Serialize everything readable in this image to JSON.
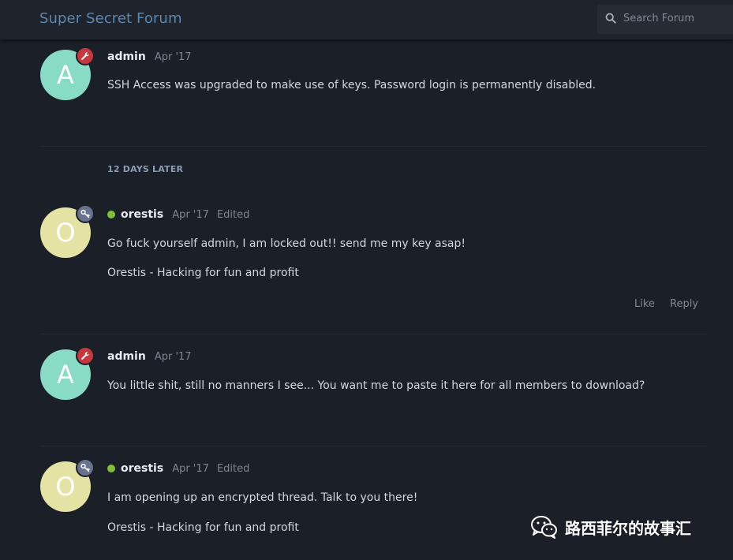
{
  "header": {
    "title": "Super Secret Forum",
    "search_placeholder": "Search Forum",
    "search_icon": "search-icon"
  },
  "posts": [
    {
      "avatar_letter": "A",
      "avatar_color": "#88dbc4",
      "role_icon": "wrench-icon",
      "username": "admin",
      "date": "Apr '17",
      "lines": [
        "SSH Access was upgraded to make use of keys. Password login is permanently disabled."
      ]
    },
    {
      "avatar_letter": "O",
      "avatar_color": "#e5e3a3",
      "role_icon": "key-icon",
      "online": true,
      "username": "orestis",
      "date": "Apr '17",
      "edited": "Edited",
      "lines": [
        "Go fuck yourself admin, I am locked out!! send me my key asap!",
        "Orestis - Hacking for fun and profit"
      ],
      "actions": {
        "like": "Like",
        "reply": "Reply"
      }
    },
    {
      "avatar_letter": "A",
      "avatar_color": "#88dbc4",
      "role_icon": "wrench-icon",
      "username": "admin",
      "date": "Apr '17",
      "lines": [
        "You little shit, still no manners I see... You want me to paste it here for all members to download?"
      ]
    },
    {
      "avatar_letter": "O",
      "avatar_color": "#e5e3a3",
      "role_icon": "key-icon",
      "online": true,
      "username": "orestis",
      "date": "Apr '17",
      "edited": "Edited",
      "lines": [
        "I am opening up an encrypted thread. Talk to you there!",
        "Orestis - Hacking for fun and profit"
      ]
    }
  ],
  "time_gap": "12 DAYS LATER",
  "watermark": {
    "icon": "wechat-icon",
    "text": "路西菲尔的故事汇"
  },
  "colors": {
    "background": "#1b1f27",
    "title": "#5d86ad",
    "admin_badge": "#c6383d",
    "user_badge": "#68718d",
    "online": "#7fc135"
  }
}
